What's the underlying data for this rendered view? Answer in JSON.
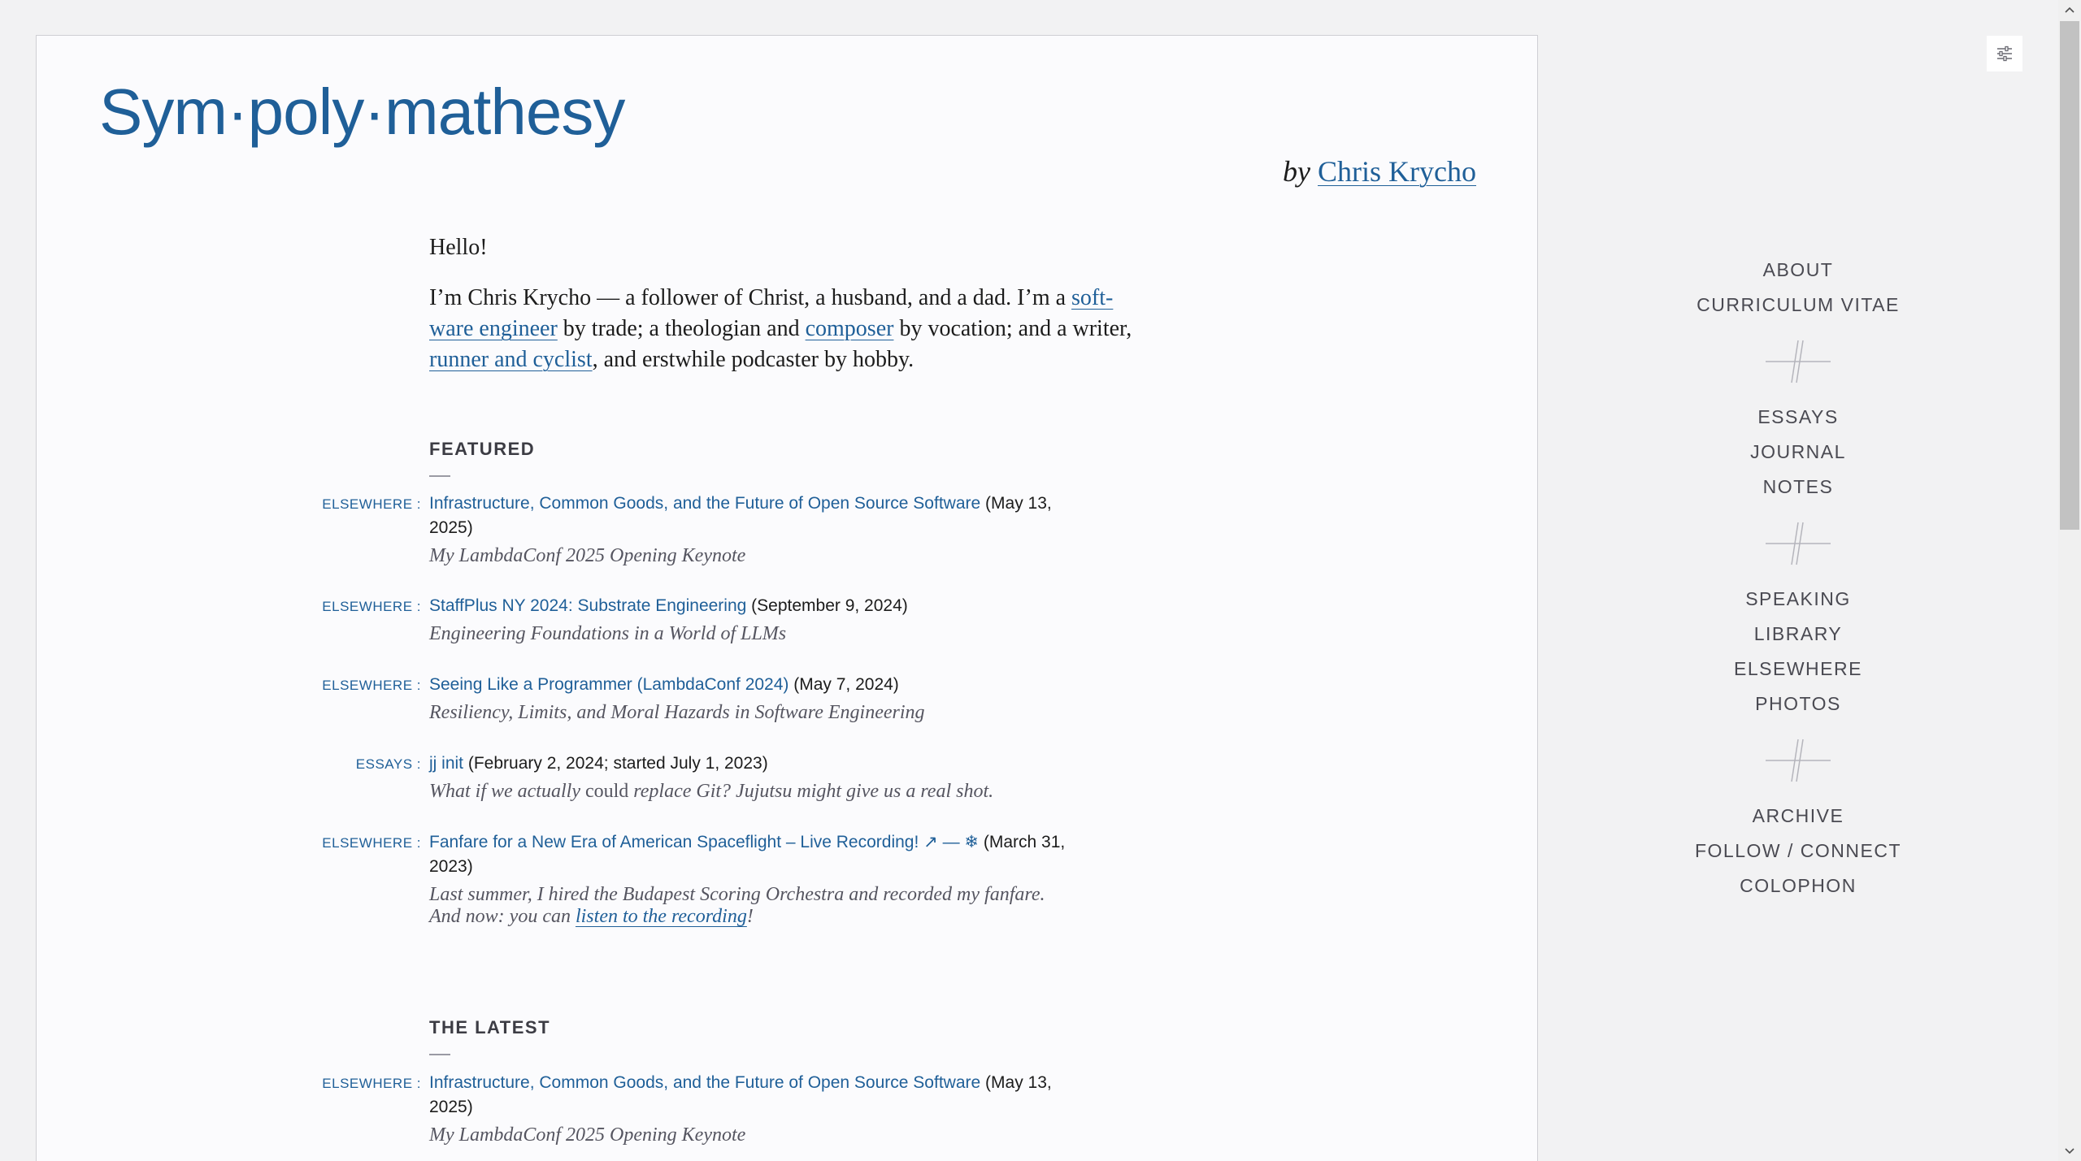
{
  "site": {
    "title": "Sym·poly·mathesy",
    "byline_prefix": "by",
    "author": "Chris Krycho"
  },
  "intro": {
    "greeting": "Hello!",
    "p1_a": "I’m Chris Krycho — a follower of Christ, a husband, and a dad. I’m a ",
    "p1_link1": "soft­ware engineer",
    "p1_b": " by trade; a theologian and ",
    "p1_link2": "composer",
    "p1_c": " by vocation; and a writer, ",
    "p1_link3": "runner and cyclist",
    "p1_d": ", and erstwhile podcaster by hobby."
  },
  "featured": {
    "heading": "FEATURED",
    "entries": [
      {
        "category": "ELSEWHERE :",
        "title": "Infrastructure, Common Goods, and the Future of Open Source Software",
        "date": " (May 13, 2025)",
        "subtitle": "My LambdaConf 2025 Opening Keynote"
      },
      {
        "category": "ELSEWHERE :",
        "title": "StaffPlus NY 2024: Substrate Engineering",
        "date": " (September 9, 2024)",
        "subtitle": "Engineering Foundations in a World of LLMs"
      },
      {
        "category": "ELSEWHERE :",
        "title": "Seeing Like a Programmer (LambdaConf 2024)",
        "date": " (May 7, 2024)",
        "subtitle": "Resiliency, Limits, and Moral Hazards in Software Engineering"
      },
      {
        "category": "ESSAYS :",
        "title": "jj init",
        "date": " (February 2, 2024; started July 1, 2023)",
        "subtitle_a": "What if we actually ",
        "subtitle_b": "could",
        "subtitle_c": " replace Git? Jujutsu might give us a real shot."
      },
      {
        "category": "ELSEWHERE :",
        "title": "Fanfare for a New Era of American Spaceflight – Live Recording!",
        "title_suffix": " ↗ — ❄",
        "date": " (March 31, 2023)",
        "subtitle_a": "Last summer, I hired the Budapest Scoring Orchestra and recorded my fanfare. And now: you can ",
        "subtitle_link": "listen to the recording",
        "subtitle_c": "!"
      }
    ]
  },
  "latest": {
    "heading": "THE LATEST",
    "entries": [
      {
        "category": "ELSEWHERE :",
        "title": "Infrastructure, Common Goods, and the Future of Open Source Software",
        "date": " (May 13, 2025)",
        "subtitle": "My LambdaConf 2025 Opening Keynote"
      }
    ]
  },
  "nav": {
    "group1": [
      "ABOUT",
      "CURRICULUM VITAE"
    ],
    "group2": [
      "ESSAYS",
      "JOURNAL",
      "NOTES"
    ],
    "group3": [
      "SPEAKING",
      "LIBRARY",
      "ELSEWHERE",
      "PHOTOS"
    ],
    "group4": [
      "ARCHIVE",
      "FOLLOW / CONNECT",
      "COLOPHON"
    ]
  },
  "icons": {
    "settings": "sliders-icon",
    "scroll_up": "chevron-up-icon",
    "scroll_down": "chevron-down-icon"
  }
}
